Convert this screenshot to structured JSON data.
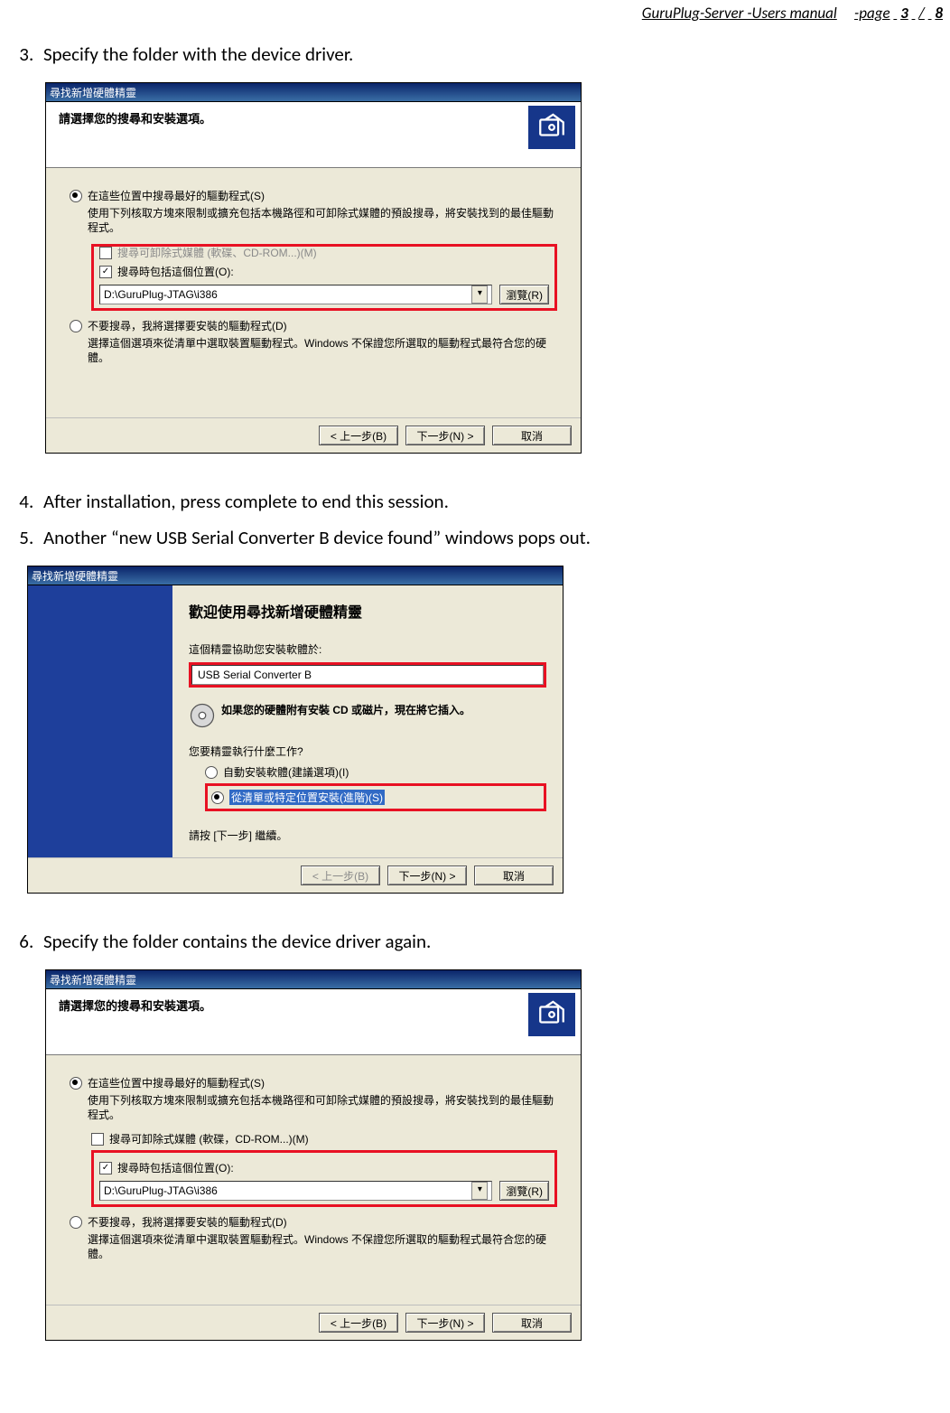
{
  "header": {
    "doc_title": "GuruPlug-Server  -Users  manual",
    "page_label": "-page",
    "page_current": "3",
    "page_sep": "/",
    "page_total": "8"
  },
  "steps": {
    "s3": "Specify the folder with the device driver.",
    "s4": "After installation, press complete to end this session.",
    "s5": "Another “new USB Serial Converter B device found” windows pops out.",
    "s6": "Specify the folder contains the device driver again."
  },
  "dialog1": {
    "title": "尋找新增硬體精靈",
    "banner": "請選擇您的搜尋和安裝選項。",
    "r1": "在這些位置中搜尋最好的驅動程式(S)",
    "r1_desc": "使用下列核取方塊來限制或擴充包括本機路徑和可卸除式媒體的預設搜尋，將安裝找到的最佳驅動程式。",
    "chk_removable": "搜尋可卸除式媒體 (軟碟、CD-ROM...)(M)",
    "chk_include": "搜尋時包括這個位置(O):",
    "path": "D:\\GuruPlug-JTAG\\i386",
    "browse": "瀏覽(R)",
    "r2": "不要搜尋，我將選擇要安裝的驅動程式(D)",
    "r2_desc": "選擇這個選項來從清單中選取裝置驅動程式。Windows 不保證您所選取的驅動程式最符合您的硬體。",
    "back": "< 上一步(B)",
    "next": "下一步(N) >",
    "cancel": "取消"
  },
  "dialog2": {
    "title": "尋找新增硬體精靈",
    "welcome": "歡迎使用尋找新增硬體精靈",
    "help_line": "這個精靈協助您安裝軟體於:",
    "device": "USB Serial Converter B",
    "cd_line": "如果您的硬體附有安裝 CD 或磁片，現在將它插入。",
    "q": "您要精靈執行什麼工作?",
    "opt_auto": "自動安裝軟體(建議選項)(I)",
    "opt_list": "從清單或特定位置安裝(進階)(S)",
    "press_next": "請按 [下一步] 繼續。",
    "back": "< 上一步(B)",
    "next": "下一步(N) >",
    "cancel": "取消"
  },
  "dialog3": {
    "title": "尋找新增硬體精靈",
    "banner": "請選擇您的搜尋和安裝選項。",
    "r1": "在這些位置中搜尋最好的驅動程式(S)",
    "r1_desc": "使用下列核取方塊來限制或擴充包括本機路徑和可卸除式媒體的預設搜尋，將安裝找到的最佳驅動程式。",
    "chk_removable": "搜尋可卸除式媒體 (軟碟，CD-ROM...)(M)",
    "chk_include": "搜尋時包括這個位置(O):",
    "path": "D:\\GuruPlug-JTAG\\i386",
    "browse": "瀏覽(R)",
    "r2": "不要搜尋，我將選擇要安裝的驅動程式(D)",
    "r2_desc": "選擇這個選項來從清單中選取裝置驅動程式。Windows 不保證您所選取的驅動程式最符合您的硬體。",
    "back": "< 上一步(B)",
    "next": "下一步(N) >",
    "cancel": "取消"
  }
}
